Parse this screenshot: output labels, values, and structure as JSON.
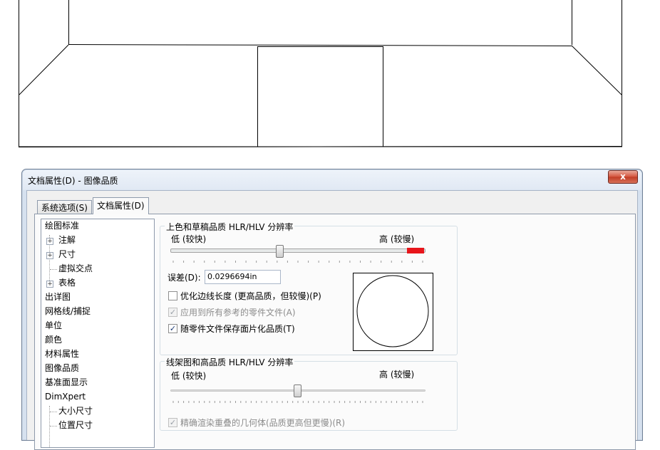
{
  "window": {
    "title": "文档属性(D) - 图像品质",
    "close_label": "x"
  },
  "tabs": [
    {
      "label": "系统选项(S)",
      "active": false
    },
    {
      "label": "文档属性(D)",
      "active": true
    }
  ],
  "tree": {
    "items": [
      {
        "label": "绘图标准",
        "level": 0
      },
      {
        "label": "注解",
        "level": 1,
        "expander": "+"
      },
      {
        "label": "尺寸",
        "level": 1,
        "expander": "+"
      },
      {
        "label": "虚拟交点",
        "level": 1
      },
      {
        "label": "表格",
        "level": 1,
        "expander": "+"
      },
      {
        "label": "出详图",
        "level": 0
      },
      {
        "label": "网格线/捕捉",
        "level": 0
      },
      {
        "label": "单位",
        "level": 0
      },
      {
        "label": "颜色",
        "level": 0
      },
      {
        "label": "材料属性",
        "level": 0
      },
      {
        "label": "图像品质",
        "level": 0,
        "selected": true
      },
      {
        "label": "基准面显示",
        "level": 0
      },
      {
        "label": "DimXpert",
        "level": 0
      },
      {
        "label": "大小尺寸",
        "level": 1
      },
      {
        "label": "位置尺寸",
        "level": 1
      }
    ]
  },
  "shaded_group": {
    "title": "上色和草稿品质 HLR/HLV 分辨率",
    "low_label": "低 (较快)",
    "high_label": "高 (较慢)",
    "slider_value": 0.43,
    "red_zone_color": "#e8151b",
    "deviation_label": "误差(D):",
    "deviation_value": "0.0296694in",
    "optimize_label": "优化边线长度 (更高品质，但较慢)(P)",
    "optimize_checked": false,
    "apply_all_label": "应用到所有参考的零件文件(A)",
    "apply_all_checked": true,
    "apply_all_enabled": false,
    "save_label": "随零件文件保存面片化品质(T)",
    "save_checked": true
  },
  "wireframe_group": {
    "title": "线架图和高品质 HLR/HLV 分辨率",
    "low_label": "低 (较快)",
    "high_label": "高 (较慢)",
    "slider_value": 0.5,
    "precise_label": "精确渲染重叠的几何体(品质更高但更慢)(R)",
    "precise_checked": true,
    "precise_enabled": false
  }
}
